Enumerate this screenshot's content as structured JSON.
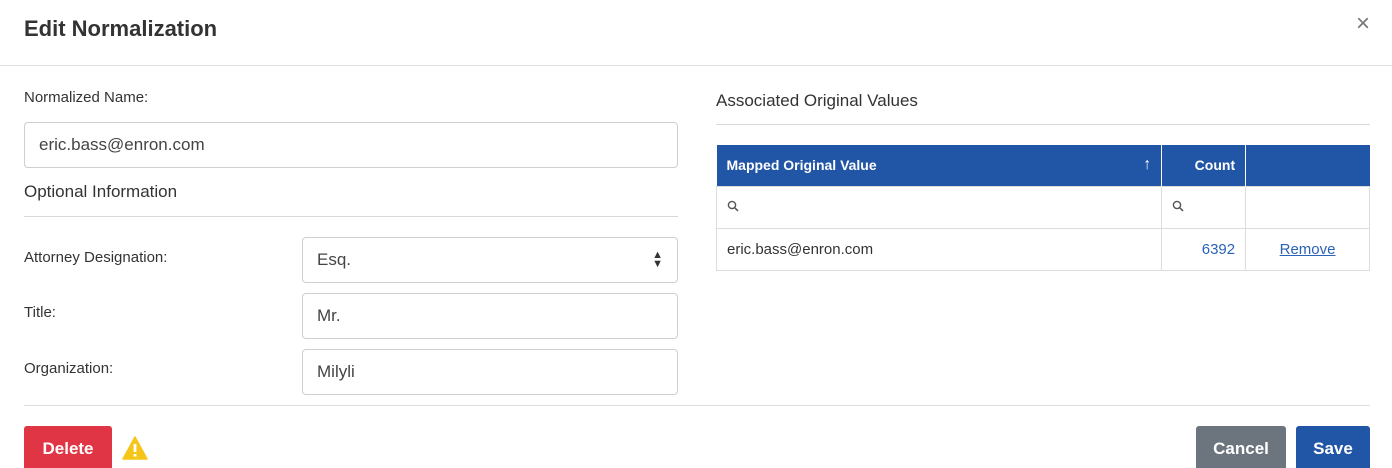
{
  "header": {
    "title": "Edit Normalization",
    "close_glyph": "×"
  },
  "form": {
    "normalized_name_label": "Normalized Name:",
    "normalized_name_value": "eric.bass@enron.com",
    "optional_title": "Optional Information",
    "attorney_label": "Attorney Designation:",
    "attorney_value": "Esq.",
    "title_label": "Title:",
    "title_value": "Mr.",
    "organization_label": "Organization:",
    "organization_value": "Milyli"
  },
  "associated": {
    "section_title": "Associated Original Values",
    "columns": [
      "Mapped Original Value",
      "Count",
      ""
    ],
    "sort_glyph": "↑",
    "search_glyph": "🔍",
    "rows": [
      {
        "value": "eric.bass@enron.com",
        "count": "6392",
        "action": "Remove"
      }
    ]
  },
  "footer": {
    "delete_label": "Delete",
    "cancel_label": "Cancel",
    "save_label": "Save"
  },
  "colors": {
    "primary": "#2155a5",
    "danger": "#e03545",
    "secondary": "#6c757d",
    "warning": "#f5c518"
  },
  "icons": {
    "warning": "warning-icon",
    "close": "close-icon",
    "sort": "sort-asc-icon",
    "search": "search-icon",
    "select": "select-arrows-icon"
  }
}
